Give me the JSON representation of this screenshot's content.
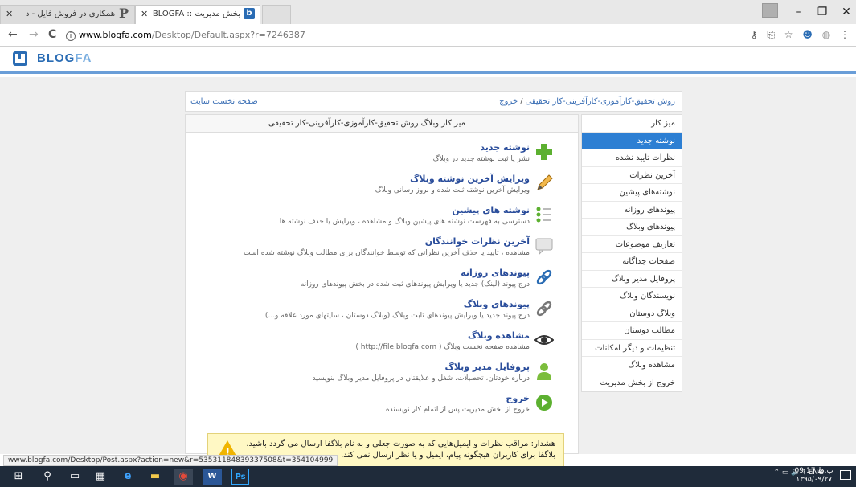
{
  "browser": {
    "tabs": [
      {
        "label": "همکاری در فروش فایل - د",
        "favicon": "P"
      },
      {
        "label": "بخش مدیریت :: BLOGFA",
        "favicon": "b"
      },
      {
        "label": ""
      }
    ],
    "window_controls": {
      "minimize": "–",
      "maximize": "❐",
      "close": "✕"
    },
    "url_host": "www.blogfa.com",
    "url_rest": "/Desktop/Default.aspx?r=7246387",
    "nav": {
      "back": "←",
      "forward": "→",
      "reload": "C"
    },
    "tool_icons": {
      "key": "⚷",
      "translate": "⎘",
      "star": "☆",
      "profile": "☻",
      "ext": "◍",
      "menu": "⋮"
    }
  },
  "site": {
    "logo_main": "BLOG",
    "logo_accent": "FA"
  },
  "breadcrumb": {
    "blog": "روش تحقیق-کارآموزی-کارآفرینی-کار تحقیقی",
    "sep": "/",
    "exit": "خروج",
    "home": "صفحه نخست سایت"
  },
  "sidebar": {
    "items": [
      {
        "label": "میز کار"
      },
      {
        "label": "نوشته جدید"
      },
      {
        "label": "نظرات تایید نشده"
      },
      {
        "label": "آخرین نظرات"
      },
      {
        "label": "نوشته‌های پیشین"
      },
      {
        "label": "پیوندهای روزانه"
      },
      {
        "label": "پیوندهای وبلاگ"
      },
      {
        "label": "تعاریف موضوعات"
      },
      {
        "label": "صفحات جداگانه"
      },
      {
        "label": "پروفایل مدیر وبلاگ"
      },
      {
        "label": "نویسندگان وبلاگ"
      },
      {
        "label": "وبلاگ دوستان"
      },
      {
        "label": "مطالب دوستان"
      },
      {
        "label": "تنظیمات و دیگر امکانات"
      },
      {
        "label": "مشاهده وبلاگ"
      },
      {
        "label": "خروج از بخش مدیریت"
      }
    ]
  },
  "main": {
    "header": "میز کار وبلاگ روش تحقیق-کارآموزی-کارآفرینی-کار تحقیقی",
    "entries": [
      {
        "title": "نوشته جدید",
        "desc": "نشر یا ثبت نوشته جدید در وبلاگ",
        "icon": "plus-icon"
      },
      {
        "title": "ویرایش آخرین نوشته وبلاگ",
        "desc": "ویرایش آخرین نوشته ثبت شده و بروز رسانی وبلاگ",
        "icon": "pencil-icon"
      },
      {
        "title": "نوشته های پیشین",
        "desc": "دسترسی به فهرست نوشته های پیشین وبلاگ و مشاهده ، ویرایش یا حذف نوشته ها",
        "icon": "list-icon"
      },
      {
        "title": "آخرین نظرات خوانندگان",
        "desc": "مشاهده ، تایید یا حذف آخرین نظراتی که توسط خوانندگان برای مطالب وبلاگ نوشته شده است",
        "icon": "comment-icon"
      },
      {
        "title": "پیوندهای روزانه",
        "desc": "درج پیوند (لینک) جدید یا ویرایش پیوندهای ثبت شده در بخش پیوندهای روزانه",
        "icon": "link-icon"
      },
      {
        "title": "پیوندهای وبلاگ",
        "desc": "درج پیوند جدید یا ویرایش پیوندهای ثابت وبلاگ (وبلاگ دوستان ، سایتهای مورد علاقه و...)",
        "icon": "link-gray-icon"
      },
      {
        "title": "مشاهده وبلاگ",
        "desc": "مشاهده صفحه نخست وبلاگ ( http://file.blogfa.com )",
        "icon": "eye-icon"
      },
      {
        "title": "پروفایل مدیر وبلاگ",
        "desc": "درباره خودتان، تحصیلات، شغل و علایقتان در پروفایل مدیر وبلاگ بنویسید",
        "icon": "user-icon"
      },
      {
        "title": "خروج",
        "desc": "خروج از بخش مدیریت پس از اتمام کار نویسنده",
        "icon": "exit-icon"
      }
    ]
  },
  "warning": {
    "line1": "هشدار: مراقب نظرات و ایمیل‌هایی که به صورت جعلی و به نام بلاگفا ارسال می گردد باشید.",
    "line2": "بلاگفا برای کاربران هیچگونه پیام، ایمیل و یا نظر ارسال نمی کند."
  },
  "status_url": "www.blogfa.com/Desktop/Post.aspx?action=new&r=53531184839337508&t=354104999",
  "taskbar": {
    "tray_text": "ENG",
    "time": "09:17 ب.ظ",
    "date": "۱۳۹۵/۰۹/۲۷"
  }
}
